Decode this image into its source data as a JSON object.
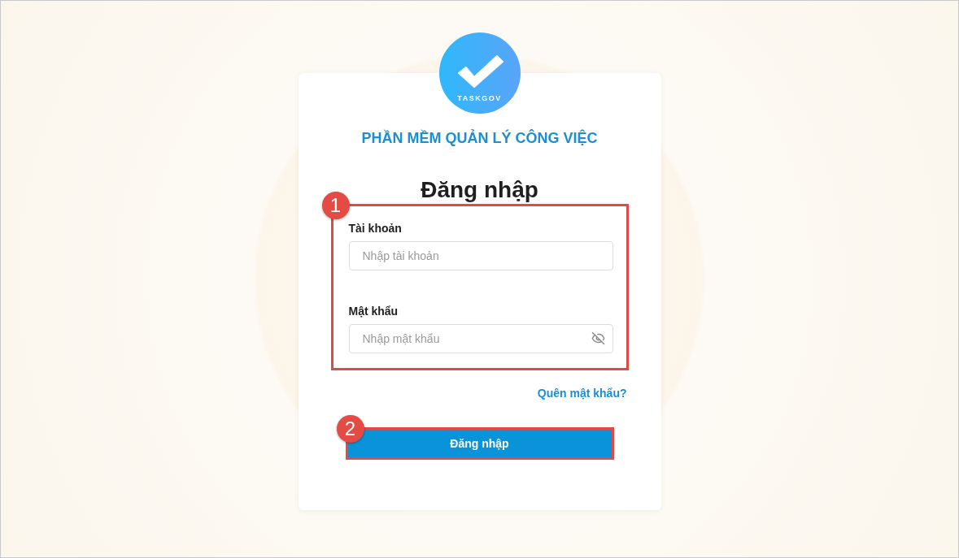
{
  "logo": {
    "text": "TASKGOV"
  },
  "app_title": "PHẦN MỀM QUẢN LÝ CÔNG VIỆC",
  "heading": "Đăng nhập",
  "fields": [
    {
      "kind": "text",
      "label": "Tài khoản",
      "placeholder": "Nhập tài khoản"
    },
    {
      "kind": "password",
      "label": "Mật khẩu",
      "placeholder": "Nhập mật khẩu"
    }
  ],
  "forgot_link": "Quên mật khẩu?",
  "submit_button": "Đăng nhập",
  "callouts": [
    "1",
    "2"
  ]
}
